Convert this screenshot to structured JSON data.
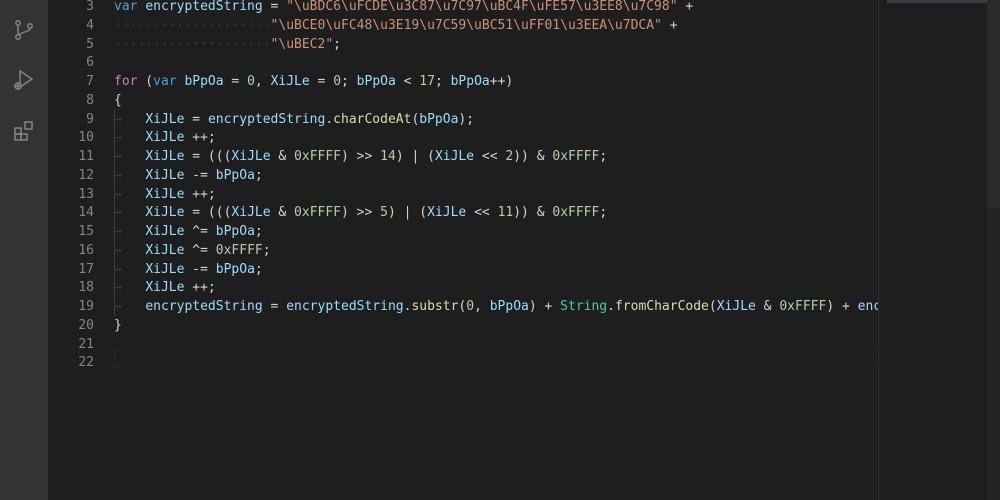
{
  "activity_bar": {
    "icons": [
      "source-control-icon",
      "run-debug-icon",
      "extensions-icon"
    ]
  },
  "editor": {
    "line_numbers": [
      "3",
      "4",
      "5",
      "6",
      "7",
      "8",
      "9",
      "10",
      "11",
      "12",
      "13",
      "14",
      "15",
      "16",
      "17",
      "18",
      "19",
      "20",
      "21",
      "22"
    ],
    "lines": [
      [
        {
          "t": "var",
          "c": "k"
        },
        {
          "t": " "
        },
        {
          "t": "encryptedString",
          "c": "v"
        },
        {
          "t": " = "
        },
        {
          "t": "\"\\uBDC6\\uFCDE\\u3C87\\u7C97\\uBC4F\\uFE57\\u3EE8\\u7C98\"",
          "c": "s"
        },
        {
          "t": " +"
        }
      ],
      [
        {
          "t": "····················",
          "c": "ws"
        },
        {
          "t": "\"\\uBCE0\\uFC48\\u3E19\\u7C59\\uBC51\\uFF01\\u3EEA\\u7DCA\"",
          "c": "s"
        },
        {
          "t": " +"
        }
      ],
      [
        {
          "t": "····················",
          "c": "ws"
        },
        {
          "t": "\"\\uBEC2\"",
          "c": "s"
        },
        {
          "t": ";"
        }
      ],
      [],
      [
        {
          "t": "for",
          "c": "ctl"
        },
        {
          "t": " ("
        },
        {
          "t": "var",
          "c": "k"
        },
        {
          "t": " "
        },
        {
          "t": "bPpOa",
          "c": "v"
        },
        {
          "t": " = "
        },
        {
          "t": "0",
          "c": "n"
        },
        {
          "t": ", "
        },
        {
          "t": "XiJLe",
          "c": "v"
        },
        {
          "t": " = "
        },
        {
          "t": "0",
          "c": "n"
        },
        {
          "t": "; "
        },
        {
          "t": "bPpOa",
          "c": "v"
        },
        {
          "t": " < "
        },
        {
          "t": "17",
          "c": "n"
        },
        {
          "t": "; "
        },
        {
          "t": "bPpOa",
          "c": "v"
        },
        {
          "t": "++)"
        }
      ],
      [
        {
          "t": "{"
        }
      ],
      [
        {
          "t": "→   ",
          "c": "ws"
        },
        {
          "t": "XiJLe",
          "c": "v"
        },
        {
          "t": " = "
        },
        {
          "t": "encryptedString",
          "c": "v"
        },
        {
          "t": "."
        },
        {
          "t": "charCodeAt",
          "c": "f"
        },
        {
          "t": "("
        },
        {
          "t": "bPpOa",
          "c": "v"
        },
        {
          "t": ");"
        }
      ],
      [
        {
          "t": "→   ",
          "c": "ws"
        },
        {
          "t": "XiJLe",
          "c": "v"
        },
        {
          "t": " ++;"
        }
      ],
      [
        {
          "t": "→   ",
          "c": "ws"
        },
        {
          "t": "XiJLe",
          "c": "v"
        },
        {
          "t": " = ((("
        },
        {
          "t": "XiJLe",
          "c": "v"
        },
        {
          "t": " & "
        },
        {
          "t": "0xFFFF",
          "c": "n"
        },
        {
          "t": ") >> "
        },
        {
          "t": "14",
          "c": "n"
        },
        {
          "t": ") | ("
        },
        {
          "t": "XiJLe",
          "c": "v"
        },
        {
          "t": " << "
        },
        {
          "t": "2",
          "c": "n"
        },
        {
          "t": ")) & "
        },
        {
          "t": "0xFFFF",
          "c": "n"
        },
        {
          "t": ";"
        }
      ],
      [
        {
          "t": "→   ",
          "c": "ws"
        },
        {
          "t": "XiJLe",
          "c": "v"
        },
        {
          "t": " -= "
        },
        {
          "t": "bPpOa",
          "c": "v"
        },
        {
          "t": ";"
        }
      ],
      [
        {
          "t": "→   ",
          "c": "ws"
        },
        {
          "t": "XiJLe",
          "c": "v"
        },
        {
          "t": " ++;"
        }
      ],
      [
        {
          "t": "→   ",
          "c": "ws"
        },
        {
          "t": "XiJLe",
          "c": "v"
        },
        {
          "t": " = ((("
        },
        {
          "t": "XiJLe",
          "c": "v"
        },
        {
          "t": " & "
        },
        {
          "t": "0xFFFF",
          "c": "n"
        },
        {
          "t": ") >> "
        },
        {
          "t": "5",
          "c": "n"
        },
        {
          "t": ") | ("
        },
        {
          "t": "XiJLe",
          "c": "v"
        },
        {
          "t": " << "
        },
        {
          "t": "11",
          "c": "n"
        },
        {
          "t": ")) & "
        },
        {
          "t": "0xFFFF",
          "c": "n"
        },
        {
          "t": ";"
        }
      ],
      [
        {
          "t": "→   ",
          "c": "ws"
        },
        {
          "t": "XiJLe",
          "c": "v"
        },
        {
          "t": " ^= "
        },
        {
          "t": "bPpOa",
          "c": "v"
        },
        {
          "t": ";"
        }
      ],
      [
        {
          "t": "→   ",
          "c": "ws"
        },
        {
          "t": "XiJLe",
          "c": "v"
        },
        {
          "t": " ^= "
        },
        {
          "t": "0xFFFF",
          "c": "n"
        },
        {
          "t": ";"
        }
      ],
      [
        {
          "t": "→   ",
          "c": "ws"
        },
        {
          "t": "XiJLe",
          "c": "v"
        },
        {
          "t": " -= "
        },
        {
          "t": "bPpOa",
          "c": "v"
        },
        {
          "t": ";"
        }
      ],
      [
        {
          "t": "→   ",
          "c": "ws"
        },
        {
          "t": "XiJLe",
          "c": "v"
        },
        {
          "t": " ++;"
        }
      ],
      [
        {
          "t": "→   ",
          "c": "ws"
        },
        {
          "t": "encryptedString",
          "c": "v"
        },
        {
          "t": " = "
        },
        {
          "t": "encryptedString",
          "c": "v"
        },
        {
          "t": "."
        },
        {
          "t": "substr",
          "c": "f"
        },
        {
          "t": "("
        },
        {
          "t": "0",
          "c": "n"
        },
        {
          "t": ", "
        },
        {
          "t": "bPpOa",
          "c": "v"
        },
        {
          "t": ") + "
        },
        {
          "t": "String",
          "c": "c"
        },
        {
          "t": "."
        },
        {
          "t": "fromCharCode",
          "c": "f"
        },
        {
          "t": "("
        },
        {
          "t": "XiJLe",
          "c": "v"
        },
        {
          "t": " & "
        },
        {
          "t": "0xFFFF",
          "c": "n"
        },
        {
          "t": ") + "
        },
        {
          "t": "encrypt",
          "c": "v"
        }
      ],
      [
        {
          "t": "}"
        }
      ],
      [],
      []
    ]
  },
  "theme": {
    "background": "#1e1e1e",
    "activity_bar": "#333333",
    "line_number": "#858585"
  }
}
